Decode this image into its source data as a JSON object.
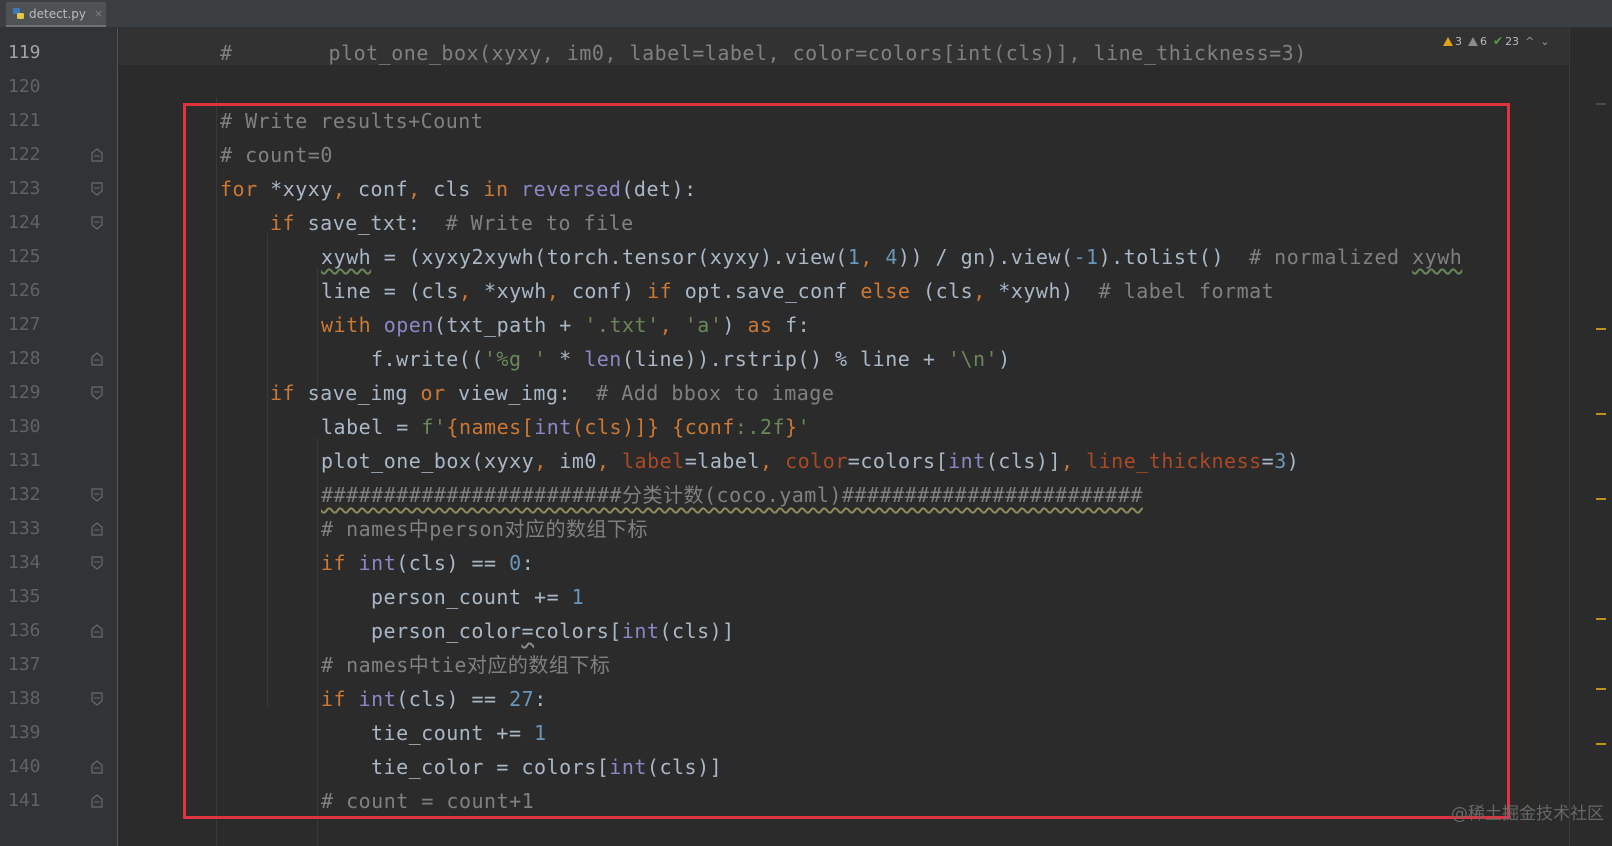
{
  "tab": {
    "filename": "detect.py",
    "close": "×",
    "icon": "python-file-icon"
  },
  "inspections": {
    "warnings": "3",
    "weak_warnings": "6",
    "typos": "23",
    "up": "^",
    "down": "⌄"
  },
  "line_numbers": [
    "119",
    "120",
    "121",
    "122",
    "123",
    "124",
    "125",
    "126",
    "127",
    "128",
    "129",
    "130",
    "131",
    "132",
    "133",
    "134",
    "135",
    "136",
    "137",
    "138",
    "139",
    "140",
    "141"
  ],
  "code": {
    "l119": {
      "hash": "#",
      "text": "plot_one_box(xyxy, im0, label=label, color=colors[int(cls)], line_thickness=3)"
    },
    "l121": "# Write results+Count",
    "l122": "# count=0",
    "l123": {
      "for": "for",
      "star_xyxy": " *xyxy",
      "c1": ",",
      "conf": " conf",
      "c2": ",",
      "cls": " cls ",
      "in": "in",
      "sp": " ",
      "reversed": "reversed",
      "tail": "(det):"
    },
    "l124": {
      "if": "if",
      "mid": " save_txt:  ",
      "comment": "# Write to file"
    },
    "l125": {
      "xywh": "xywh",
      "a": " = (xyxy2xywh(torch.tensor(xyxy).view(",
      "one": "1",
      "comma": ",",
      "sp": " ",
      "four": "4",
      "b": ")) / gn).view(",
      "neg": "-1",
      "c": ").tolist()  ",
      "comment": "# normalized ",
      "cxywh": "xywh"
    },
    "l126": {
      "a": "line = (cls",
      "c1": ",",
      "b": " *xywh",
      "c2": ",",
      "c": " conf) ",
      "if": "if",
      "d": " opt.save_conf ",
      "else": "else",
      "e": " (cls",
      "c3": ",",
      "f": " *xywh)  ",
      "comment": "# label format"
    },
    "l127": {
      "with": "with",
      "sp": " ",
      "open": "open",
      "a": "(txt_path + ",
      "s1": "'.txt'",
      "c1": ",",
      "sp2": " ",
      "s2": "'a'",
      "b": ") ",
      "as": "as",
      "c": " f:"
    },
    "l128": {
      "a": "f.write((",
      "s1": "'%g '",
      "b": " * ",
      "len": "len",
      "c": "(line)).rstrip() % line + ",
      "s2": "'\\n'",
      "d": ")"
    },
    "l129": {
      "if": "if",
      "a": " save_img ",
      "or": "or",
      "b": " view_img:  ",
      "comment": "# Add bbox to image"
    },
    "l130": {
      "a": "label = ",
      "f": "f'",
      "b": "{names[",
      "int": "int",
      "c": "(cls)]} ",
      "d": "{conf",
      "fmt": ":.2f",
      "e": "}",
      "q": "'"
    },
    "l131": {
      "a": "plot_one_box(xyxy",
      "c1": ",",
      "b": " im0",
      "c2": ",",
      "sp": " ",
      "label": "label",
      "c": "=label",
      "c3": ",",
      "sp2": " ",
      "color": "color",
      "d": "=colors[",
      "int": "int",
      "e": "(cls)]",
      "c4": ",",
      "sp3": " ",
      "lt": "line_thickness",
      "eq": "=",
      "three": "3",
      "f": ")"
    },
    "l132": "########################分类计数(coco.yaml)########################",
    "l133": "# names中person对应的数组下标",
    "l134": {
      "if": "if",
      "sp": " ",
      "int": "int",
      "a": "(cls) == ",
      "zero": "0",
      "b": ":"
    },
    "l135": {
      "a": "person_count += ",
      "one": "1"
    },
    "l136": {
      "a": "person_color",
      "eq": "=",
      "b": "colors[",
      "int": "int",
      "c": "(cls)]"
    },
    "l137": "# names中tie对应的数组下标",
    "l138": {
      "if": "if",
      "sp": " ",
      "int": "int",
      "a": "(cls) == ",
      "num": "27",
      "b": ":"
    },
    "l139": {
      "a": "tie_count += ",
      "one": "1"
    },
    "l140": {
      "a": "tie_color = colors[",
      "int": "int",
      "b": "(cls)]"
    },
    "l141": "# count = count+1"
  },
  "watermark": "@稀土掘金技术社区",
  "colors": {
    "background": "#2b2b2b",
    "keyword": "#cc7832",
    "comment": "#808080",
    "string": "#6a8759",
    "number": "#6897bb",
    "builtin": "#8888c6",
    "param": "#aa4926",
    "highlight_box": "#e0333f"
  }
}
